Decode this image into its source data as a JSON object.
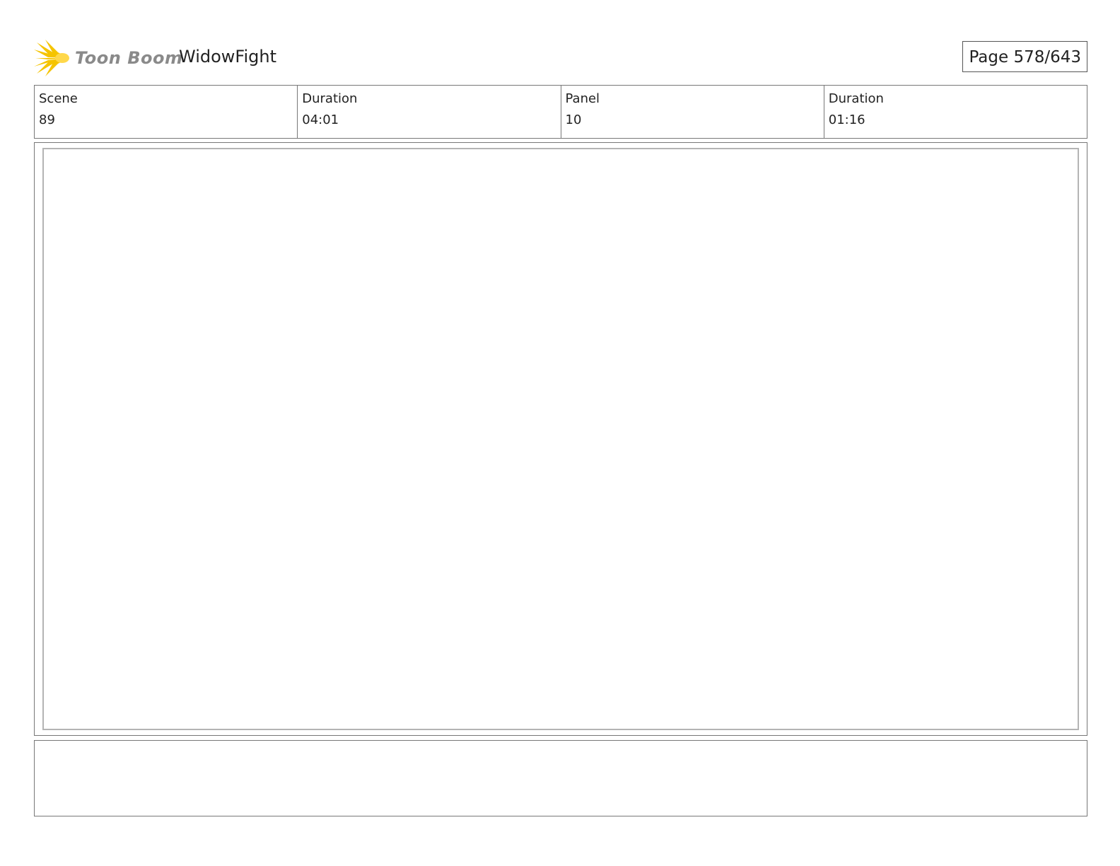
{
  "header": {
    "logo_text": "Toon Boom",
    "logo_icon": "starburst-icon",
    "project_title": "WidowFight",
    "page_label": "Page 578/643"
  },
  "info": {
    "scene_label": "Scene",
    "scene_value": "89",
    "scene_duration_label": "Duration",
    "scene_duration_value": "04:01",
    "panel_label": "Panel",
    "panel_value": "10",
    "panel_duration_label": "Duration",
    "panel_duration_value": "01:16"
  },
  "colors": {
    "logo_yellow": "#f5c400",
    "logo_text": "#8a8a8a",
    "border": "#777777",
    "panel_inner_border": "#b4b4b4"
  }
}
